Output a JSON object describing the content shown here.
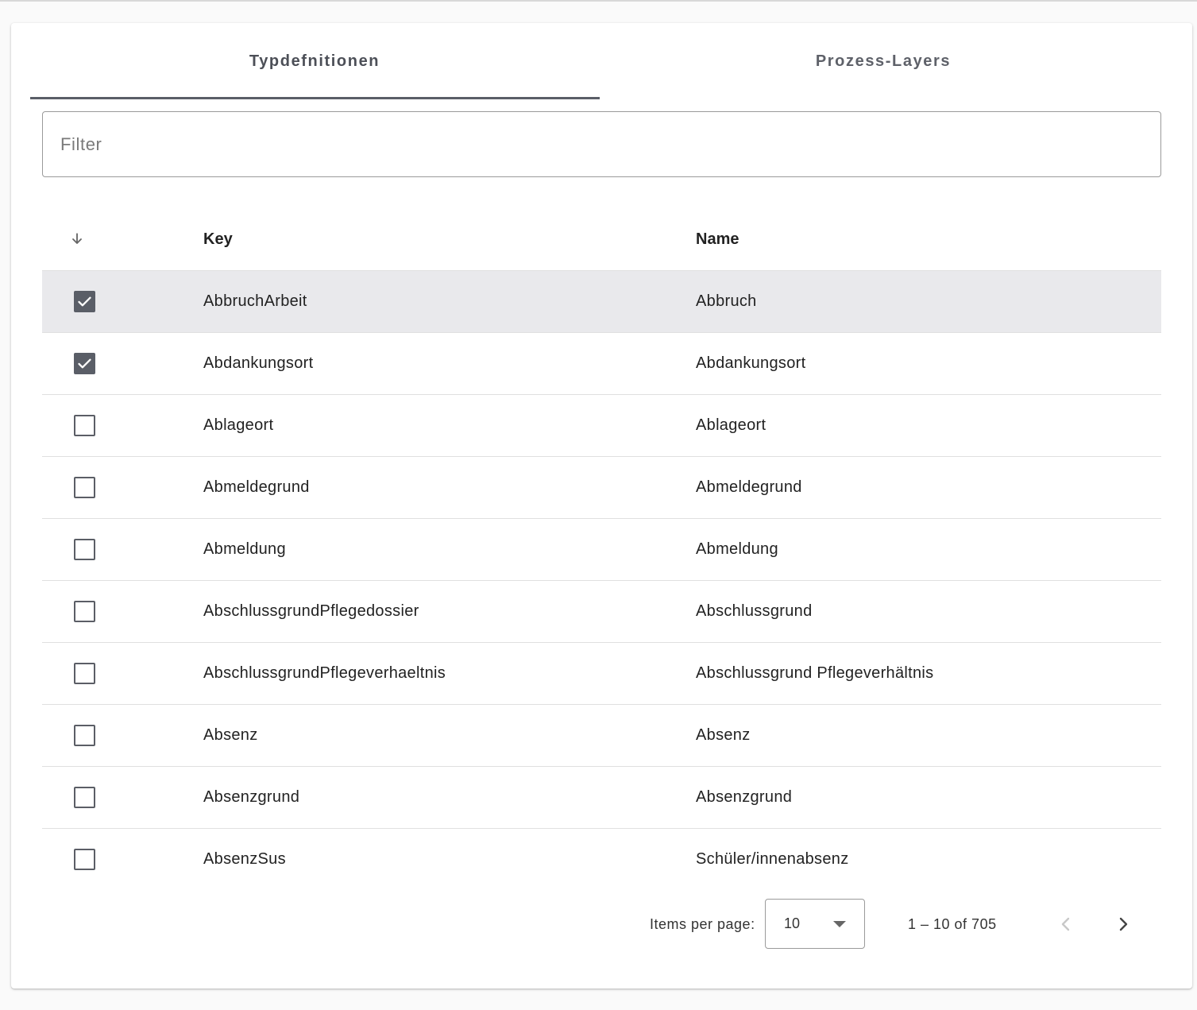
{
  "tabs": [
    {
      "label": "Typdefnitionen",
      "active": true
    },
    {
      "label": "Prozess-Layers",
      "active": false
    }
  ],
  "filter": {
    "placeholder": "Filter",
    "value": ""
  },
  "table": {
    "sort_icon": "arrow-down-icon",
    "headers": {
      "key": "Key",
      "name": "Name"
    },
    "rows": [
      {
        "key": "AbbruchArbeit",
        "name": "Abbruch",
        "checked": true
      },
      {
        "key": "Abdankungsort",
        "name": "Abdankungsort",
        "checked": true
      },
      {
        "key": "Ablageort",
        "name": "Ablageort",
        "checked": false
      },
      {
        "key": "Abmeldegrund",
        "name": "Abmeldegrund",
        "checked": false
      },
      {
        "key": "Abmeldung",
        "name": "Abmeldung",
        "checked": false
      },
      {
        "key": "AbschlussgrundPflegedossier",
        "name": "Abschlussgrund",
        "checked": false
      },
      {
        "key": "AbschlussgrundPflegeverhaeltnis",
        "name": "Abschlussgrund Pflegeverhältnis",
        "checked": false
      },
      {
        "key": "Absenz",
        "name": "Absenz",
        "checked": false
      },
      {
        "key": "Absenzgrund",
        "name": "Absenzgrund",
        "checked": false
      },
      {
        "key": "AbsenzSus",
        "name": "Schüler/innenabsenz",
        "checked": false
      }
    ]
  },
  "paginator": {
    "items_per_page_label": "Items per page:",
    "page_size": "10",
    "range_label": "1 – 10 of 705",
    "prev_icon": "chevron-left-icon",
    "next_icon": "chevron-right-icon"
  },
  "colors": {
    "accent": "#5a5e67",
    "selected_row": "#e9e9ec",
    "divider": "#e0e0e0"
  }
}
